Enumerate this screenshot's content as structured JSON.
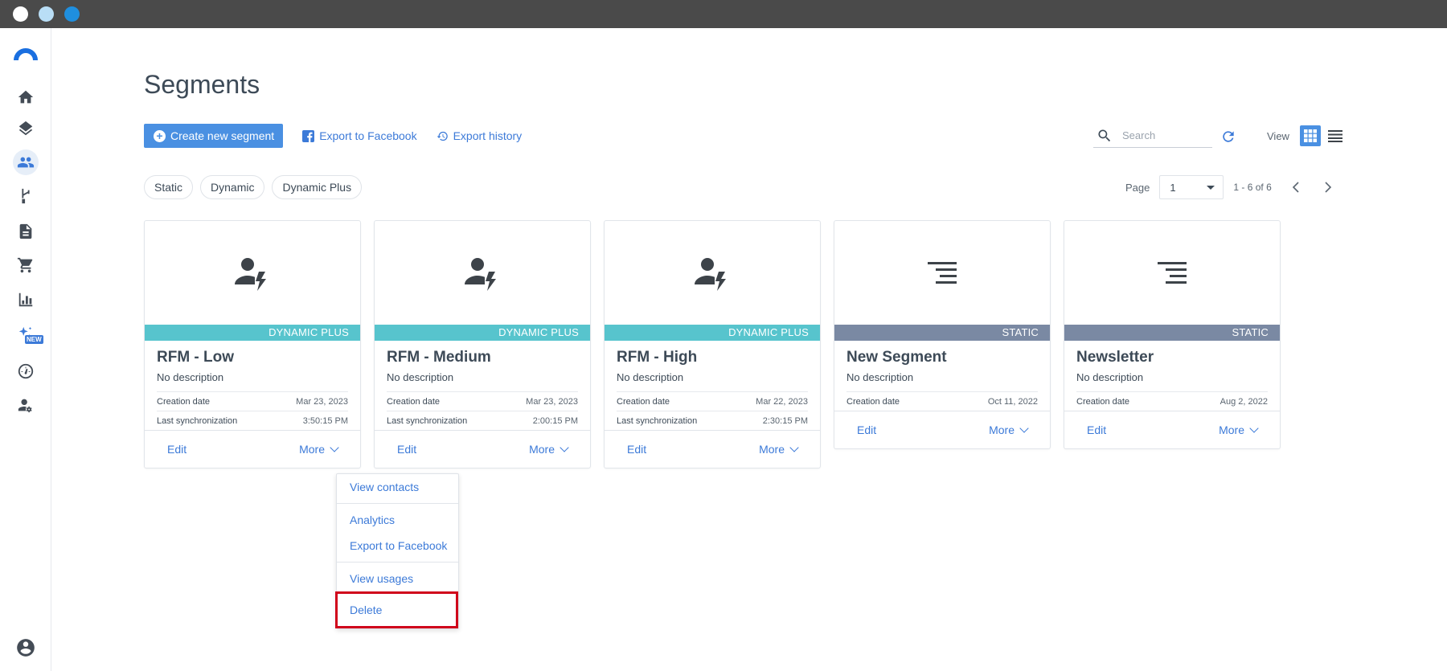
{
  "page": {
    "title": "Segments"
  },
  "toolbar": {
    "create_label": "Create new segment",
    "export_facebook_label": "Export to Facebook",
    "export_history_label": "Export history"
  },
  "search": {
    "placeholder": "Search"
  },
  "view": {
    "label": "View"
  },
  "filters": [
    "Static",
    "Dynamic",
    "Dynamic Plus"
  ],
  "pager": {
    "label": "Page",
    "current": "1",
    "range": "1 - 6 of 6"
  },
  "sidebar": {
    "new_badge": "NEW"
  },
  "cards": [
    {
      "type_label": "DYNAMIC PLUS",
      "title": "RFM - Low",
      "desc": "No description",
      "creation_label": "Creation date",
      "creation_date": "Mar 23, 2023",
      "sync_label": "Last synchronization",
      "sync_time": "3:50:15 PM",
      "edit": "Edit",
      "more": "More"
    },
    {
      "type_label": "DYNAMIC PLUS",
      "title": "RFM - Medium",
      "desc": "No description",
      "creation_label": "Creation date",
      "creation_date": "Mar 23, 2023",
      "sync_label": "Last synchronization",
      "sync_time": "2:00:15 PM",
      "edit": "Edit",
      "more": "More"
    },
    {
      "type_label": "DYNAMIC PLUS",
      "title": "RFM - High",
      "desc": "No description",
      "creation_label": "Creation date",
      "creation_date": "Mar 22, 2023",
      "sync_label": "Last synchronization",
      "sync_time": "2:30:15 PM",
      "edit": "Edit",
      "more": "More"
    },
    {
      "type_label": "STATIC",
      "title": "New Segment",
      "desc": "No description",
      "creation_label": "Creation date",
      "creation_date": "Oct 11, 2022",
      "edit": "Edit",
      "more": "More"
    },
    {
      "type_label": "STATIC",
      "title": "Newsletter",
      "desc": "No description",
      "creation_label": "Creation date",
      "creation_date": "Aug 2, 2022",
      "edit": "Edit",
      "more": "More"
    }
  ],
  "menu": {
    "view_contacts": "View contacts",
    "analytics": "Analytics",
    "export_facebook": "Export to Facebook",
    "view_usages": "View usages",
    "delete": "Delete"
  },
  "colors": {
    "primary": "#4a90e2",
    "dynamic_plus_banner": "#57c4cd",
    "static_banner": "#7a89a3",
    "highlight": "#d0021b"
  }
}
